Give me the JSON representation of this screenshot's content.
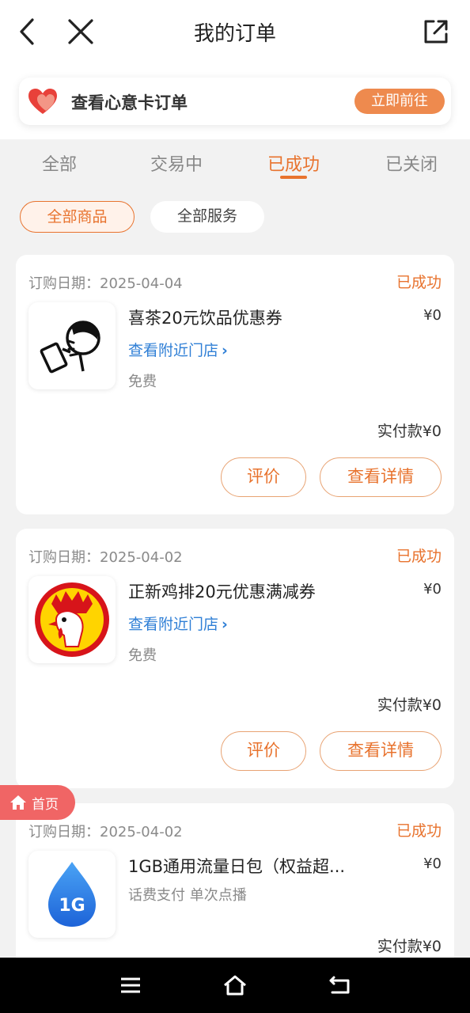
{
  "header": {
    "title": "我的订单",
    "back_icon": "chevron-left-icon",
    "close_icon": "close-icon",
    "share_icon": "share-external-icon"
  },
  "banner": {
    "icon": "heart-icon",
    "text": "查看心意卡订单",
    "button_label": "立即前往"
  },
  "tabs": [
    {
      "label": "全部",
      "active": false
    },
    {
      "label": "交易中",
      "active": false
    },
    {
      "label": "已成功",
      "active": true
    },
    {
      "label": "已关闭",
      "active": false
    }
  ],
  "filters": [
    {
      "label": "全部商品",
      "active": true
    },
    {
      "label": "全部服务",
      "active": false
    }
  ],
  "orders": [
    {
      "date": "订购日期：2025-04-04",
      "status": "已成功",
      "name": "喜茶20元饮品优惠券",
      "price": "¥0",
      "store_link": "查看附近门店",
      "note": "免费",
      "paid": "实付款¥0",
      "review_label": "评价",
      "detail_label": "查看详情"
    },
    {
      "date": "订购日期：2025-04-02",
      "status": "已成功",
      "name": "正新鸡排20元优惠满减券",
      "price": "¥0",
      "store_link": "查看附近门店",
      "note": "免费",
      "paid": "实付款¥0",
      "review_label": "评价",
      "detail_label": "查看详情"
    },
    {
      "date": "订购日期：2025-04-02",
      "status": "已成功",
      "name": "1GB通用流量日包（权益超...",
      "price": "¥0",
      "note": "话费支付 单次点播",
      "paid": "实付款¥0",
      "badge_text": "1G"
    }
  ],
  "float_home": {
    "label": "首页",
    "icon": "home-icon"
  },
  "system_nav": {
    "menu_icon": "menu-icon",
    "home_icon": "home-outline-icon",
    "back_icon": "back-arrow-icon"
  },
  "colors": {
    "accent": "#e8732e",
    "link": "#2f7fd6",
    "float": "#f06565"
  }
}
